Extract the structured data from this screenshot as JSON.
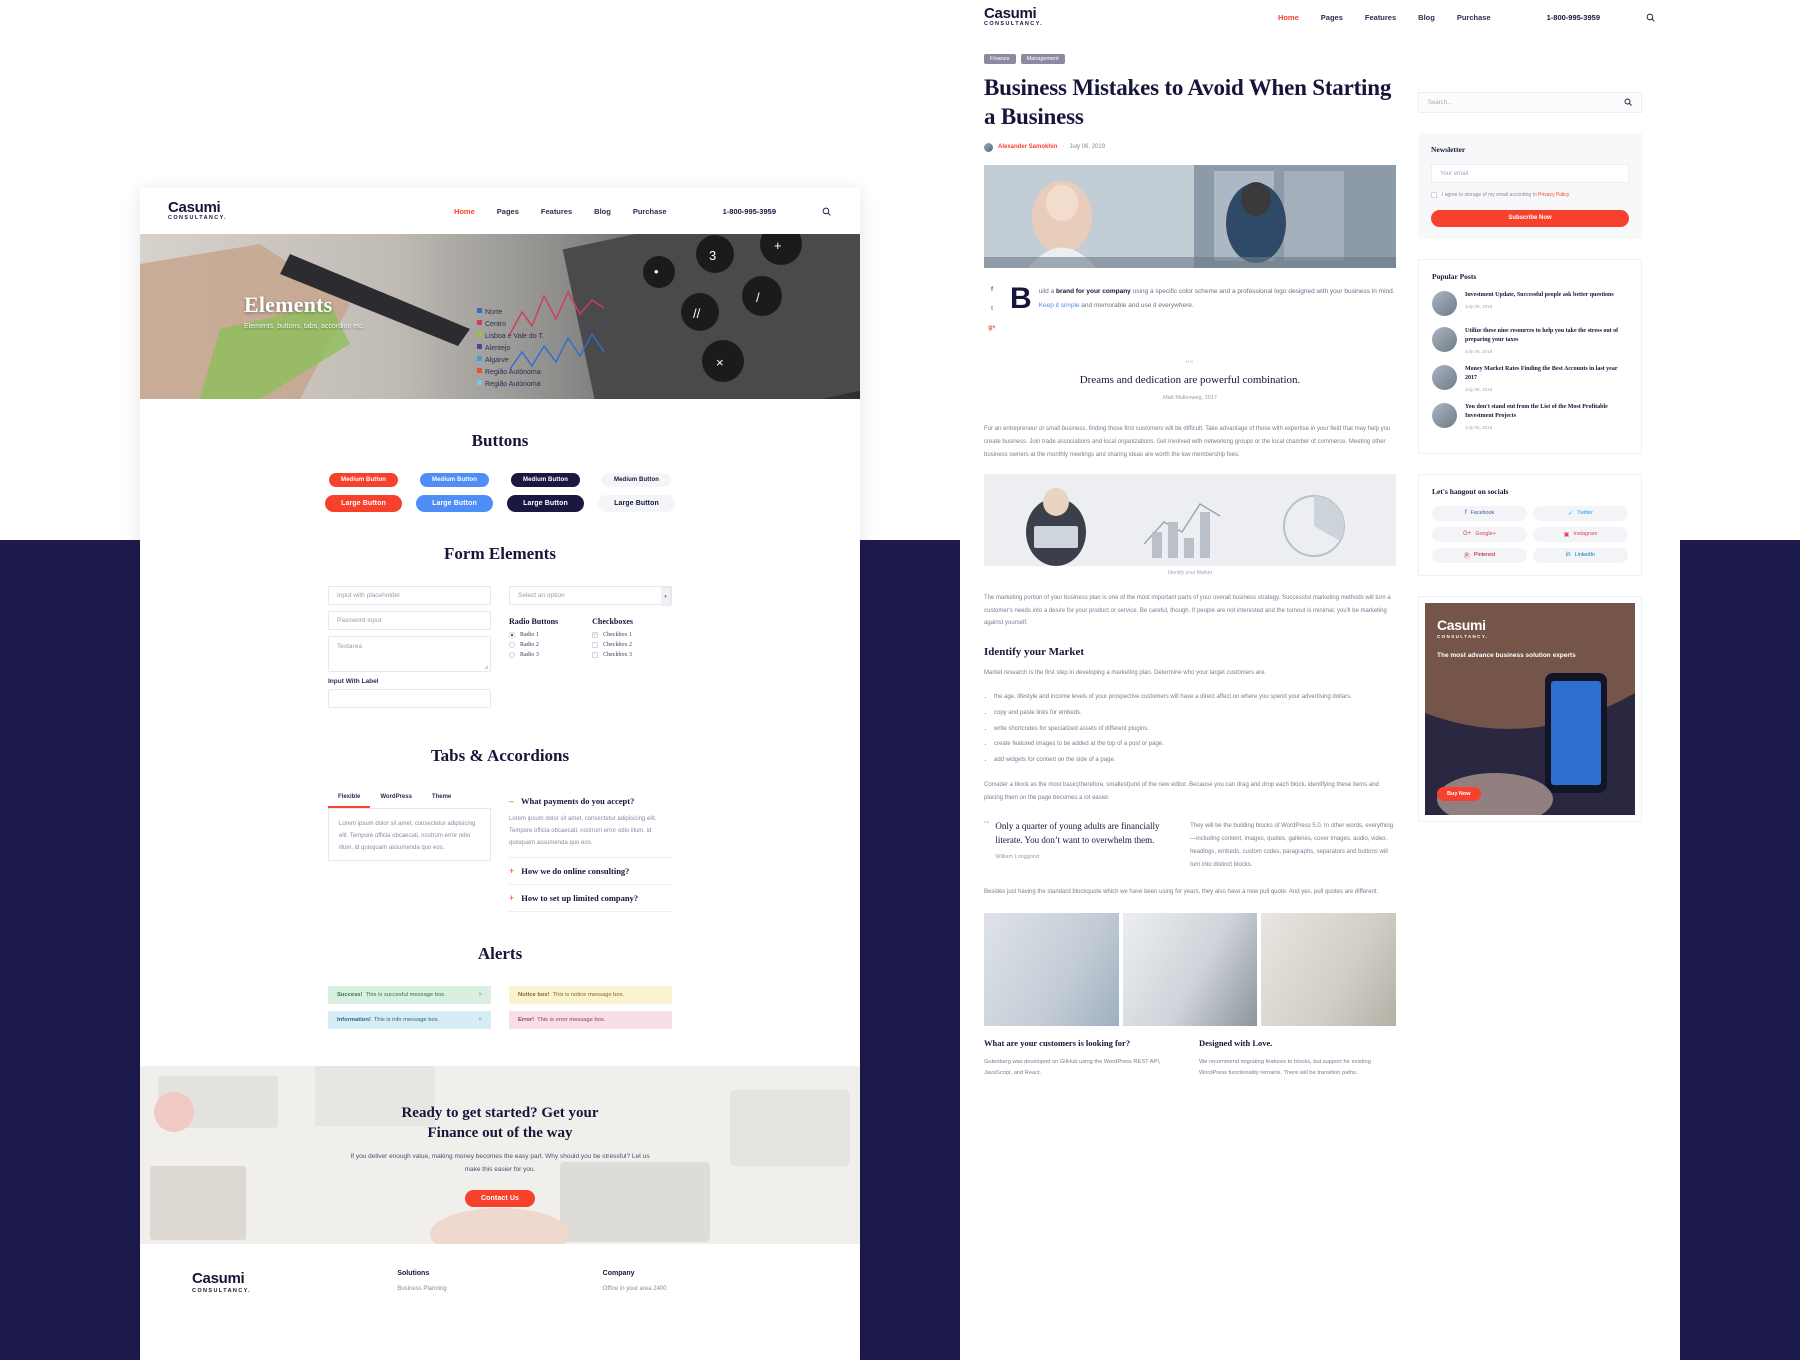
{
  "brand": {
    "name": "Casumi",
    "sub": "CONSULTANCY."
  },
  "nav": {
    "links": [
      "Home",
      "Pages",
      "Features",
      "Blog",
      "Purchase"
    ],
    "phone": "1-800-995-3959",
    "search_icon": "search-icon"
  },
  "left": {
    "hero": {
      "title": "Elements",
      "subtitle": "Elements, buttons, tabs, accordion etc."
    },
    "buttons": {
      "title": "Buttons",
      "columns": [
        {
          "style": "red",
          "medium": "Medium Button",
          "large": "Large Button"
        },
        {
          "style": "blue",
          "medium": "Medium Button",
          "large": "Large Button"
        },
        {
          "style": "dark",
          "medium": "Medium Button",
          "large": "Large Button"
        },
        {
          "style": "light",
          "medium": "Medium Button",
          "large": "Large Button"
        }
      ]
    },
    "form": {
      "title": "Form Elements",
      "input_placeholder": "Input with placeholder",
      "password_placeholder": "Password input",
      "textarea_placeholder": "Textarea",
      "label": "Input With Label",
      "label_value": "",
      "select_value": "Select an option",
      "radio_title": "Radio Buttons",
      "radios": [
        "Radio 1",
        "Radio 2",
        "Radio 3"
      ],
      "checkbox_title": "Checkboxes",
      "checkboxes": [
        "Checkbox 1",
        "Checkbox 2",
        "Checkbox 3"
      ]
    },
    "tabs": {
      "title": "Tabs & Accordions",
      "items": [
        "Flexible",
        "WordPress",
        "Theme"
      ],
      "body": "Lorem ipsum dolor sit amet, consectetur adipisicing elit. Tempore officia obcaecati, nostrum error odio illum, id quisquam assumenda quo eos.",
      "accordion": [
        {
          "q": "What payments do you accept?",
          "sign": "–",
          "open": true,
          "a": "Lorem ipsum dolor sit amet, consectetur adipisicing elit. Tempore officia obcaecati, nostrum error odio illum, id quisquam assumenda quo eos."
        },
        {
          "q": "How we do online consulting?",
          "sign": "+",
          "open": false,
          "a": ""
        },
        {
          "q": "How to set up limited company?",
          "sign": "+",
          "open": false,
          "a": ""
        }
      ]
    },
    "alerts": {
      "title": "Alerts",
      "items": [
        {
          "kind": "success",
          "strong": "Success!",
          "text": "This is succesful message box.",
          "close": "×"
        },
        {
          "kind": "notice",
          "strong": "Notice box!",
          "text": "This is notice message box.",
          "close": "×"
        },
        {
          "kind": "info",
          "strong": "Information!",
          "text": "This is info message box.",
          "close": "×"
        },
        {
          "kind": "error",
          "strong": "Error!",
          "text": "This is error message box.",
          "close": "×"
        }
      ]
    },
    "cta": {
      "line1": "Ready to get started? Get your",
      "line2": "Finance out of the way",
      "sub": "If you deliver enough value, making money becomes the easy part. Why should you be stressful? Let us make this easier for you.",
      "button": "Contact Us"
    },
    "footer": {
      "columns": [
        {
          "head": "",
          "links": []
        },
        {
          "head": "Solutions",
          "links": [
            "Business Planning"
          ]
        },
        {
          "head": "Company",
          "links": [
            "Office in your area 2400"
          ]
        }
      ]
    }
  },
  "right": {
    "tags": [
      "Finance",
      "Management"
    ],
    "title": "Business Mistakes to Avoid When Starting a Business",
    "author": "Alexander Samokhin",
    "date": "July 06, 2019",
    "share": [
      "f",
      "t",
      "g+"
    ],
    "lead": {
      "dropcap": "B",
      "html_parts": [
        "uild a ",
        "brand for your company",
        " using a specific color scheme and a professional logo designed with your business in mind. ",
        "Keep it simple",
        " and memorable and use it everywhere."
      ]
    },
    "pullquote": {
      "mark": "““",
      "text": "Dreams and dedication are powerful combination.",
      "by": "Matt Mullenweg, 2017"
    },
    "para1": "For an entrepreneur or small business, finding those first customers will be difficult. Take advantage of those with expertise in your field that may help you create business. Join trade associations and local organizations. Get involved with networking groups or the local chamber of commerce. Meeting other business owners at the monthly meetings and sharing ideas are worth the low membership fees.",
    "img_caption": "Identify your Market",
    "para2": "The marketing portion of your business plan is one of the most important parts of your overall business strategy. Successful marketing methods will turn a customer's needs into a desire for your product or service. Be careful, though. If people are not interested and the turnout is minimal, you'll be marketing against yourself.",
    "heading2": "Identify your Market",
    "para3": "Market research is the first step in developing a marketing plan. Determine who your target customers are.",
    "bullets": [
      "the age, lifestyle and income levels of your prospective customers will have a direct affect on where you spend your advertising dollars.",
      "copy and paste links for embeds.",
      "write shortcodes for specialized assets of different plugins.",
      "create featured images to be added at the top of a post or page.",
      "add widgets for content on the side of a page."
    ],
    "para4": "Consider a block as the most basic(therefore, smallest)unit of the new editor. Because you can drag and drop each block, identifying these items and placing them on the page becomes a lot easier.",
    "blockquote": {
      "mark": "““",
      "text": "Only a quarter of young adults are financially literate. You don’t want to overwhelm them.",
      "by": "William Longgood"
    },
    "bq_right": "They will be the building blocks of WordPress 5.0. In other words, everything —including content, images, quotes, galleries, cover images, audio, video, headings, embeds, custom codes, paragraphs, separators and buttons will turn into distinct blocks.",
    "para5": "Besides just having the standard blockquote which we have been using for years, they also have a new pull quote. And yes, pull quotes are different.",
    "two_col": [
      {
        "head": "What are your customers is looking for?",
        "body": "Gutenberg was developed on GitHub using the WordPress REST API, JavaScript, and React."
      },
      {
        "head": "Designed with Love.",
        "body": "We recommend migrating features to blocks, but support for existing WordPress functionality remains. There will be transition paths."
      }
    ],
    "sidebar": {
      "search_placeholder": "Search...",
      "search_icon": "search-icon",
      "newsletter": {
        "title": "Newsletter",
        "email_placeholder": "Your email",
        "agree_text": "I agree to storage of my email according to ",
        "agree_link": "Privacy Policy",
        "button": "Subscribe Now"
      },
      "popular": {
        "title": "Popular Posts",
        "items": [
          {
            "title": "Investment Update, Successful people ask better questions",
            "date": "July 06, 2019"
          },
          {
            "title": "Utilize these nine resources to help you take the stress out of preparing your taxes",
            "date": "July 06, 2019"
          },
          {
            "title": "Money Market Rates Finding the Best Accounts in last year 2017",
            "date": "July 06, 2019"
          },
          {
            "title": "You don't stand out from the List of the Most Profitable Investment Projects",
            "date": "July 06, 2019"
          }
        ]
      },
      "socials": {
        "title": "Let's hangout on socials",
        "items": [
          {
            "name": "Facebook",
            "glyph": "f",
            "cls": "c-fb"
          },
          {
            "name": "Twitter",
            "glyph": "✓",
            "cls": "c-tw"
          },
          {
            "name": "Google+",
            "glyph": "G+",
            "cls": "c-gp"
          },
          {
            "name": "Instagram",
            "glyph": "▣",
            "cls": "c-ig"
          },
          {
            "name": "Pinterest",
            "glyph": "Ⓟ",
            "cls": "c-pi"
          },
          {
            "name": "LinkedIn",
            "glyph": "in",
            "cls": "c-li"
          }
        ]
      },
      "promo": {
        "brand": "Casumi",
        "brand_sub": "CONSULTANCY.",
        "text": "The most advance business solution experts",
        "button": "Buy Now"
      }
    }
  },
  "colors": {
    "accent": "#f8412d",
    "dark": "#16153a",
    "blue": "#4f8ef7",
    "page_bg": "#1c1b4b"
  }
}
